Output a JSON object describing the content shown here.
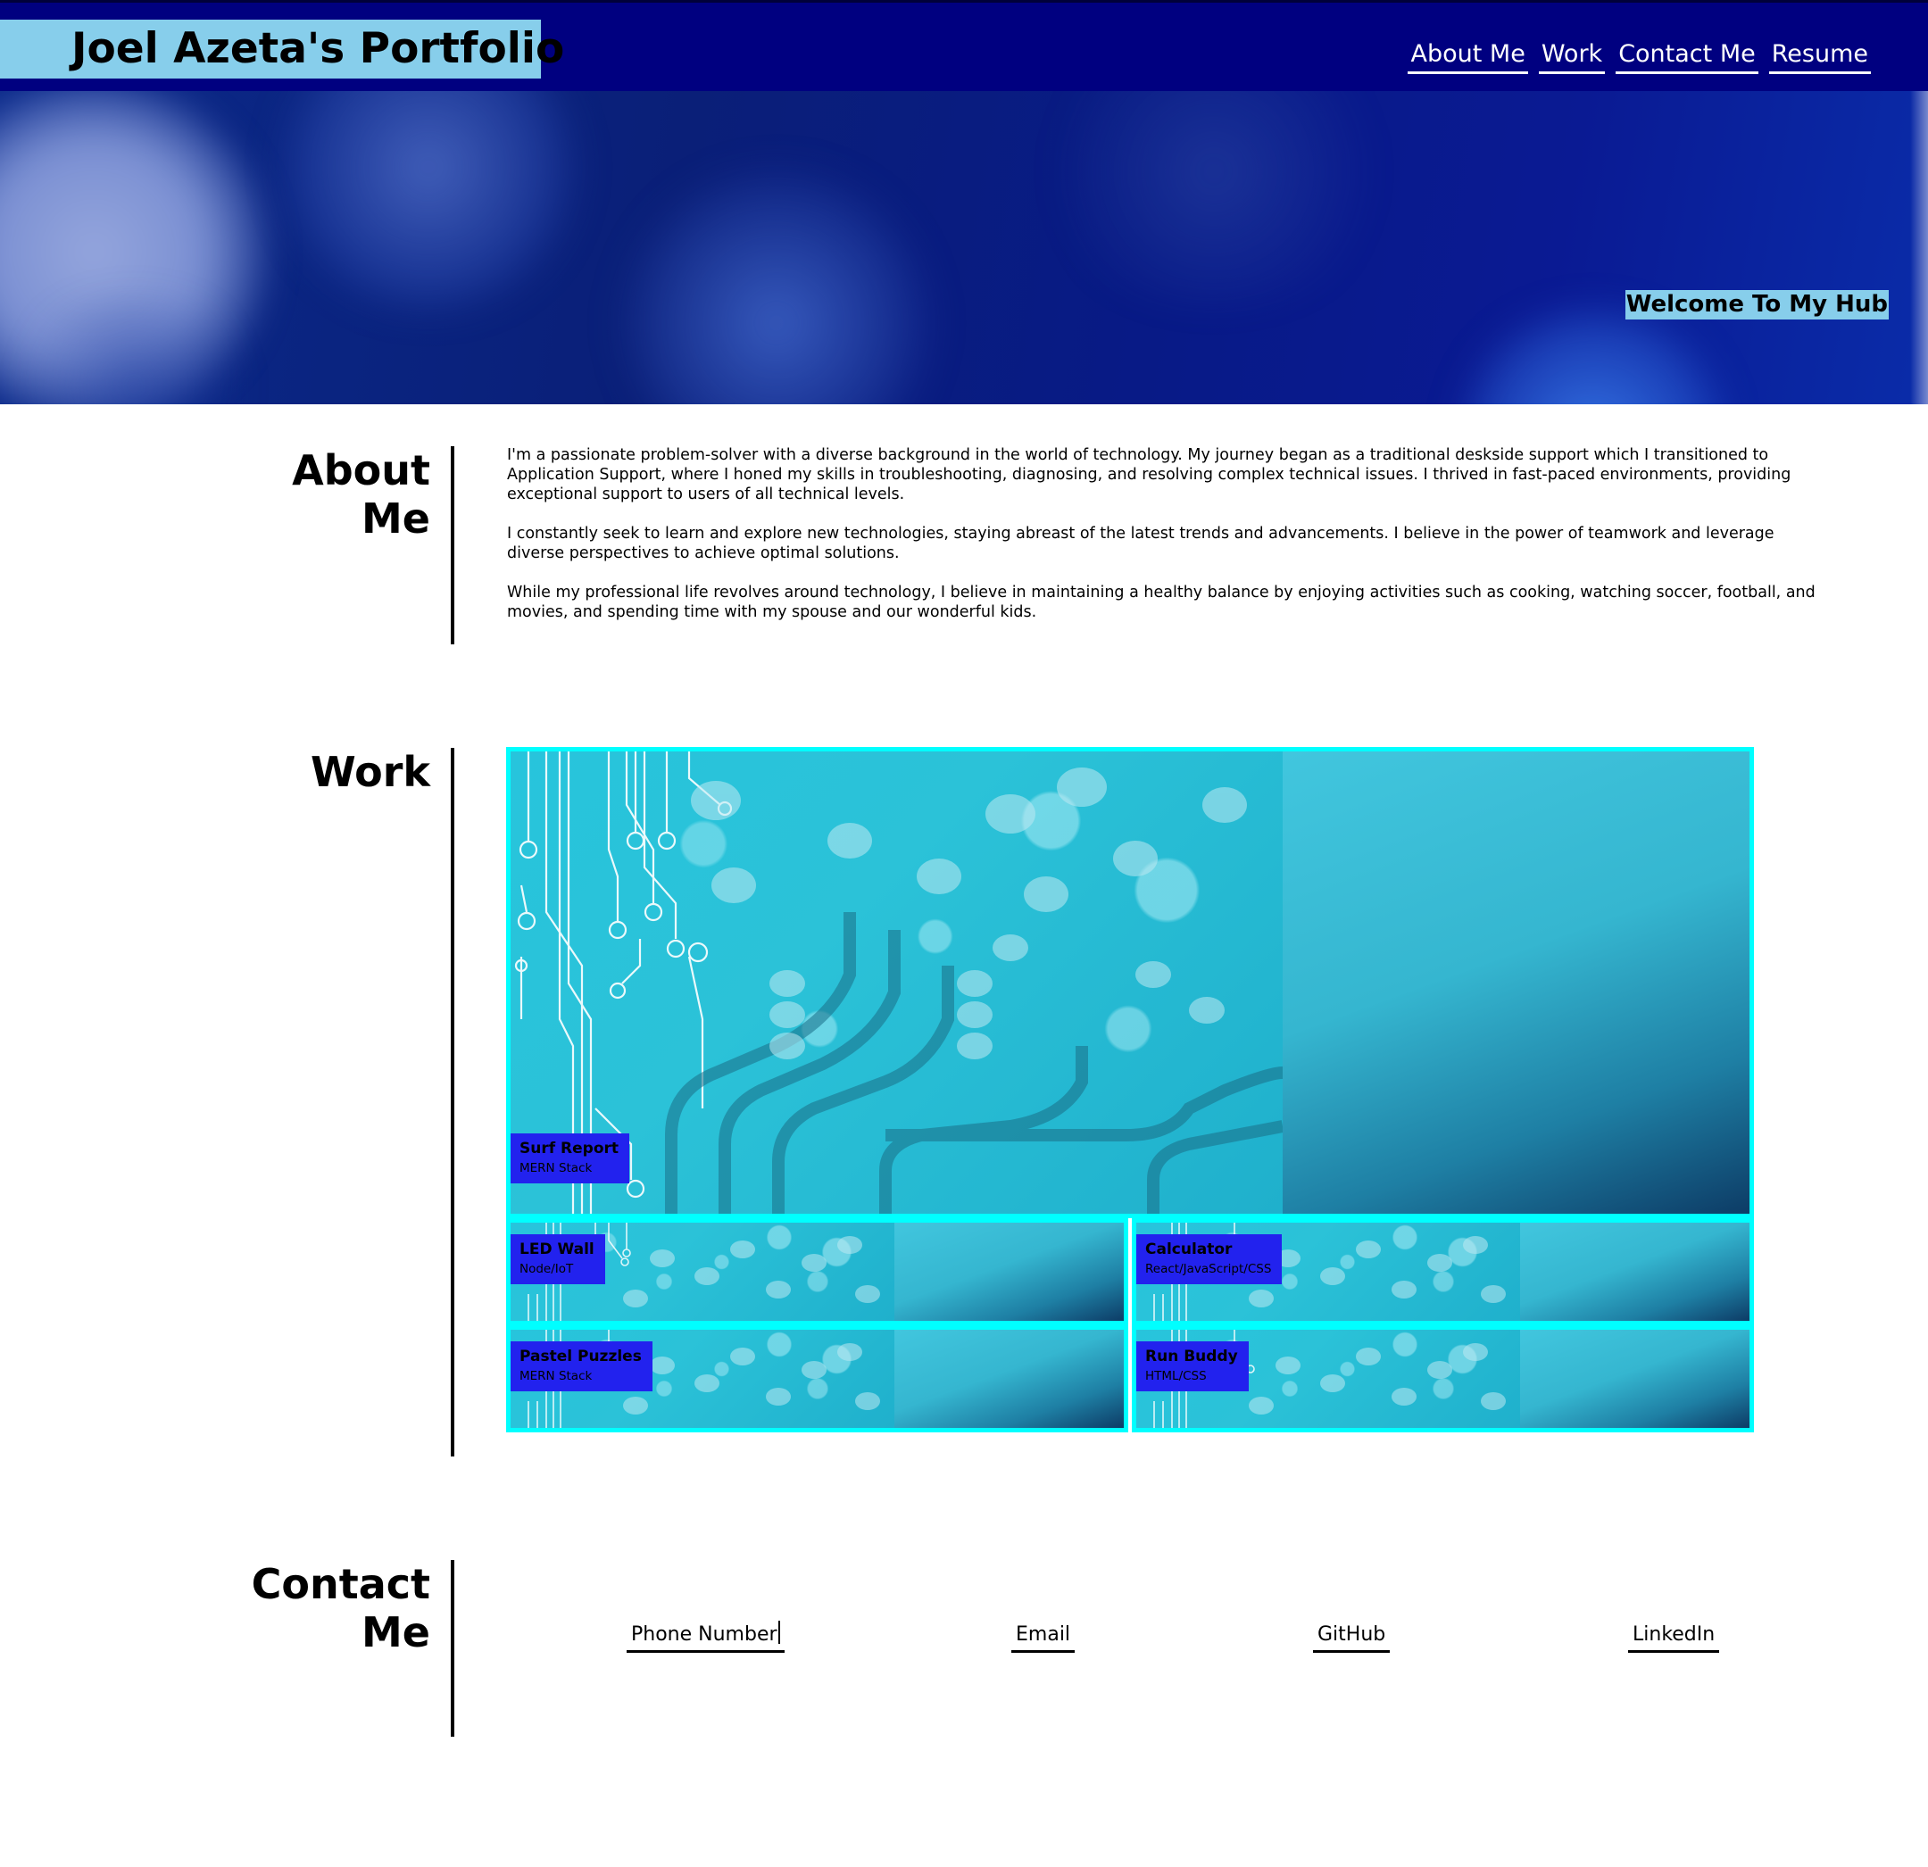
{
  "header": {
    "title": "Joel Azeta's Portfolio",
    "nav": [
      "About Me",
      "Work",
      "Contact Me",
      "Resume"
    ]
  },
  "hero": {
    "tagline": "Welcome To My Hub"
  },
  "about": {
    "heading_line1": "About",
    "heading_line2": "Me",
    "paragraphs": [
      "I'm a passionate problem-solver with a diverse background in the world of technology. My journey began as a traditional deskside support which I transitioned to Application Support, where I honed my skills in troubleshooting, diagnosing, and resolving complex technical issues. I thrived in fast-paced environments, providing exceptional support to users of all technical levels.",
      "I constantly seek to learn and explore new technologies, staying abreast of the latest trends and advancements. I believe in the power of teamwork and leverage diverse perspectives to achieve optimal solutions.",
      "While my professional life revolves around technology, I believe in maintaining a healthy balance by enjoying activities such as cooking, watching soccer, football, and movies, and spending time with my spouse and our wonderful kids."
    ]
  },
  "work": {
    "heading": "Work",
    "projects": [
      {
        "name": "Surf Report",
        "stack": "MERN Stack"
      },
      {
        "name": "LED Wall",
        "stack": "Node/IoT"
      },
      {
        "name": "Calculator",
        "stack": "React/JavaScript/CSS"
      },
      {
        "name": "Pastel Puzzles",
        "stack": "MERN Stack"
      },
      {
        "name": "Run Buddy",
        "stack": "HTML/CSS"
      }
    ]
  },
  "contact": {
    "heading_line1": "Contact",
    "heading_line2": "Me",
    "links": [
      "Phone Number",
      "Email",
      "GitHub",
      "LinkedIn"
    ]
  },
  "colors": {
    "header_bg": "#000080",
    "title_bg": "#87ceeb",
    "card_border": "#00ffff",
    "card_label_bg": "#2222ee"
  }
}
